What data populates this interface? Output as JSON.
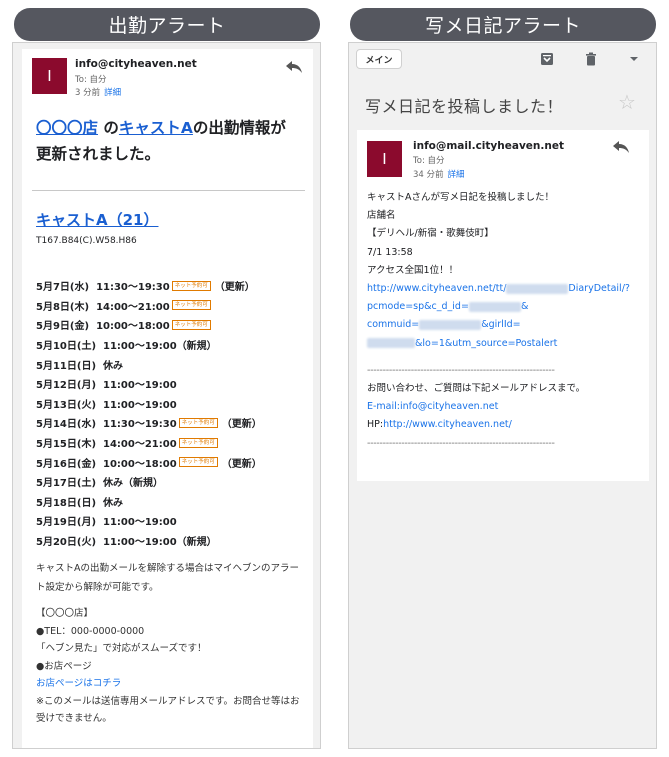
{
  "left_banner": "出勤アラート",
  "right_banner": "写メ日記アラート",
  "left_email": {
    "avatar_letter": "I",
    "sender": "info@cityheaven.net",
    "to": "To: 自分",
    "time": "3 分前",
    "detail": "詳細",
    "headline": {
      "shop_link": "〇〇〇店",
      "mid1": " の",
      "cast_link": "キャストA",
      "tail": "の出勤情報が更新されました。"
    },
    "cast_name": "キャストA（21）",
    "cast_spec": "T167.B84(C).W58.H86",
    "schedule": [
      {
        "date": "5月7日(水)",
        "time": "11:30〜19:30",
        "badge": "ネット予約可",
        "note": "（更新）"
      },
      {
        "date": "5月8日(木)",
        "time": "14:00〜21:00",
        "badge": "ネット予約可",
        "note": ""
      },
      {
        "date": "5月9日(金)",
        "time": "10:00〜18:00",
        "badge": "ネット予約可",
        "note": ""
      },
      {
        "date": "5月10日(土)",
        "time": "11:00〜19:00（新規）",
        "badge": "",
        "note": ""
      },
      {
        "date": "5月11日(日)",
        "time": "休み",
        "badge": "",
        "note": ""
      },
      {
        "date": "5月12日(月)",
        "time": "11:00〜19:00",
        "badge": "",
        "note": ""
      },
      {
        "date": "5月13日(火)",
        "time": "11:00〜19:00",
        "badge": "",
        "note": ""
      },
      {
        "date": "5月14日(水)",
        "time": "11:30〜19:30",
        "badge": "ネット予約可",
        "note": "（更新）"
      },
      {
        "date": "5月15日(木)",
        "time": "14:00〜21:00",
        "badge": "ネット予約可",
        "note": ""
      },
      {
        "date": "5月16日(金)",
        "time": "10:00〜18:00",
        "badge": "ネット予約可",
        "note": "（更新）"
      },
      {
        "date": "5月17日(土)",
        "time": "休み（新規）",
        "badge": "",
        "note": ""
      },
      {
        "date": "5月18日(日)",
        "time": "休み",
        "badge": "",
        "note": ""
      },
      {
        "date": "5月19日(月)",
        "time": "11:00〜19:00",
        "badge": "",
        "note": ""
      },
      {
        "date": "5月20日(火)",
        "time": "11:00〜19:00（新規）",
        "badge": "",
        "note": ""
      }
    ],
    "unsubscribe": "キャストAの出勤メールを解除する場合はマイヘブンのアラート設定から解除が可能です。",
    "footer": {
      "shop": "【〇〇〇店】",
      "tel": "●TEL：000-0000-0000",
      "tip": "「ヘブン見た」で対応がスムーズです！",
      "page_label": "●お店ページ",
      "page_link": "お店ページはコチラ",
      "notice": "※このメールは送信専用メールアドレスです。お問合せ等はお受けできません。"
    }
  },
  "right_email": {
    "main_button": "メイン",
    "subject": "写メ日記を投稿しました！",
    "avatar_letter": "I",
    "sender": "info@mail.cityheaven.net",
    "to": "To: 自分",
    "time": "34 分前",
    "detail": "詳細",
    "lines": {
      "l1": "キャストAさんが写メ日記を投稿しました！",
      "l2": "店舗名",
      "l3": "【デリヘル/新宿・歌舞伎町】",
      "l4": "7/1 13:58",
      "l5": "アクセス全国1位！！",
      "url_a": "http://www.cityheaven.net/tt/",
      "url_b": "DiaryDetail/?",
      "url_c": "pcmode=sp&c_d_id=",
      "url_d": "&",
      "url_e": "commuid=",
      "url_f": "&girlId=",
      "url_g": "&lo=1&utm_source=Postalert",
      "dashes": "------------------------------------------------------------",
      "inquiry": "お問い合わせ、ご質問は下記メールアドレスまで。",
      "email": "E-mail:info@cityheaven.net",
      "hp_label": "HP:",
      "hp_link": "http://www.cityheaven.net/"
    }
  },
  "colors": {
    "banner": "#55575f",
    "avatar": "#8b0a2d",
    "link": "#1a5fd1",
    "badge": "#e07a00"
  }
}
